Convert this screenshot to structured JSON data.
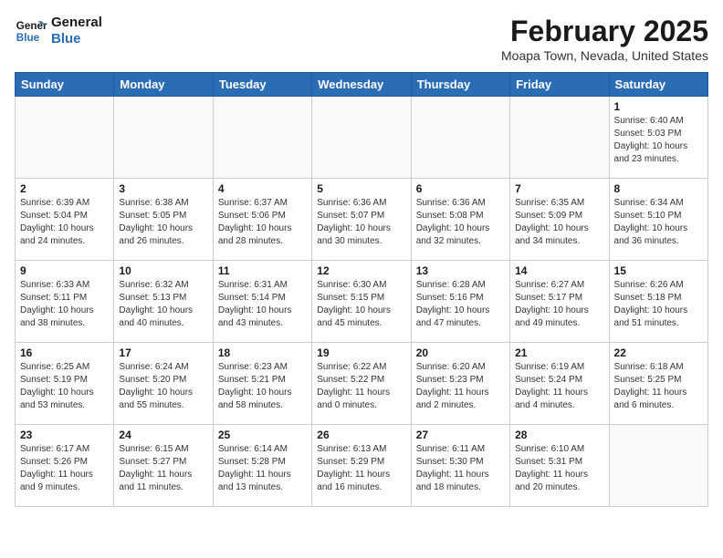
{
  "header": {
    "logo_line1": "General",
    "logo_line2": "Blue",
    "title": "February 2025",
    "subtitle": "Moapa Town, Nevada, United States"
  },
  "weekdays": [
    "Sunday",
    "Monday",
    "Tuesday",
    "Wednesday",
    "Thursday",
    "Friday",
    "Saturday"
  ],
  "weeks": [
    [
      {
        "day": "",
        "info": ""
      },
      {
        "day": "",
        "info": ""
      },
      {
        "day": "",
        "info": ""
      },
      {
        "day": "",
        "info": ""
      },
      {
        "day": "",
        "info": ""
      },
      {
        "day": "",
        "info": ""
      },
      {
        "day": "1",
        "info": "Sunrise: 6:40 AM\nSunset: 5:03 PM\nDaylight: 10 hours and 23 minutes."
      }
    ],
    [
      {
        "day": "2",
        "info": "Sunrise: 6:39 AM\nSunset: 5:04 PM\nDaylight: 10 hours and 24 minutes."
      },
      {
        "day": "3",
        "info": "Sunrise: 6:38 AM\nSunset: 5:05 PM\nDaylight: 10 hours and 26 minutes."
      },
      {
        "day": "4",
        "info": "Sunrise: 6:37 AM\nSunset: 5:06 PM\nDaylight: 10 hours and 28 minutes."
      },
      {
        "day": "5",
        "info": "Sunrise: 6:36 AM\nSunset: 5:07 PM\nDaylight: 10 hours and 30 minutes."
      },
      {
        "day": "6",
        "info": "Sunrise: 6:36 AM\nSunset: 5:08 PM\nDaylight: 10 hours and 32 minutes."
      },
      {
        "day": "7",
        "info": "Sunrise: 6:35 AM\nSunset: 5:09 PM\nDaylight: 10 hours and 34 minutes."
      },
      {
        "day": "8",
        "info": "Sunrise: 6:34 AM\nSunset: 5:10 PM\nDaylight: 10 hours and 36 minutes."
      }
    ],
    [
      {
        "day": "9",
        "info": "Sunrise: 6:33 AM\nSunset: 5:11 PM\nDaylight: 10 hours and 38 minutes."
      },
      {
        "day": "10",
        "info": "Sunrise: 6:32 AM\nSunset: 5:13 PM\nDaylight: 10 hours and 40 minutes."
      },
      {
        "day": "11",
        "info": "Sunrise: 6:31 AM\nSunset: 5:14 PM\nDaylight: 10 hours and 43 minutes."
      },
      {
        "day": "12",
        "info": "Sunrise: 6:30 AM\nSunset: 5:15 PM\nDaylight: 10 hours and 45 minutes."
      },
      {
        "day": "13",
        "info": "Sunrise: 6:28 AM\nSunset: 5:16 PM\nDaylight: 10 hours and 47 minutes."
      },
      {
        "day": "14",
        "info": "Sunrise: 6:27 AM\nSunset: 5:17 PM\nDaylight: 10 hours and 49 minutes."
      },
      {
        "day": "15",
        "info": "Sunrise: 6:26 AM\nSunset: 5:18 PM\nDaylight: 10 hours and 51 minutes."
      }
    ],
    [
      {
        "day": "16",
        "info": "Sunrise: 6:25 AM\nSunset: 5:19 PM\nDaylight: 10 hours and 53 minutes."
      },
      {
        "day": "17",
        "info": "Sunrise: 6:24 AM\nSunset: 5:20 PM\nDaylight: 10 hours and 55 minutes."
      },
      {
        "day": "18",
        "info": "Sunrise: 6:23 AM\nSunset: 5:21 PM\nDaylight: 10 hours and 58 minutes."
      },
      {
        "day": "19",
        "info": "Sunrise: 6:22 AM\nSunset: 5:22 PM\nDaylight: 11 hours and 0 minutes."
      },
      {
        "day": "20",
        "info": "Sunrise: 6:20 AM\nSunset: 5:23 PM\nDaylight: 11 hours and 2 minutes."
      },
      {
        "day": "21",
        "info": "Sunrise: 6:19 AM\nSunset: 5:24 PM\nDaylight: 11 hours and 4 minutes."
      },
      {
        "day": "22",
        "info": "Sunrise: 6:18 AM\nSunset: 5:25 PM\nDaylight: 11 hours and 6 minutes."
      }
    ],
    [
      {
        "day": "23",
        "info": "Sunrise: 6:17 AM\nSunset: 5:26 PM\nDaylight: 11 hours and 9 minutes."
      },
      {
        "day": "24",
        "info": "Sunrise: 6:15 AM\nSunset: 5:27 PM\nDaylight: 11 hours and 11 minutes."
      },
      {
        "day": "25",
        "info": "Sunrise: 6:14 AM\nSunset: 5:28 PM\nDaylight: 11 hours and 13 minutes."
      },
      {
        "day": "26",
        "info": "Sunrise: 6:13 AM\nSunset: 5:29 PM\nDaylight: 11 hours and 16 minutes."
      },
      {
        "day": "27",
        "info": "Sunrise: 6:11 AM\nSunset: 5:30 PM\nDaylight: 11 hours and 18 minutes."
      },
      {
        "day": "28",
        "info": "Sunrise: 6:10 AM\nSunset: 5:31 PM\nDaylight: 11 hours and 20 minutes."
      },
      {
        "day": "",
        "info": ""
      }
    ]
  ]
}
